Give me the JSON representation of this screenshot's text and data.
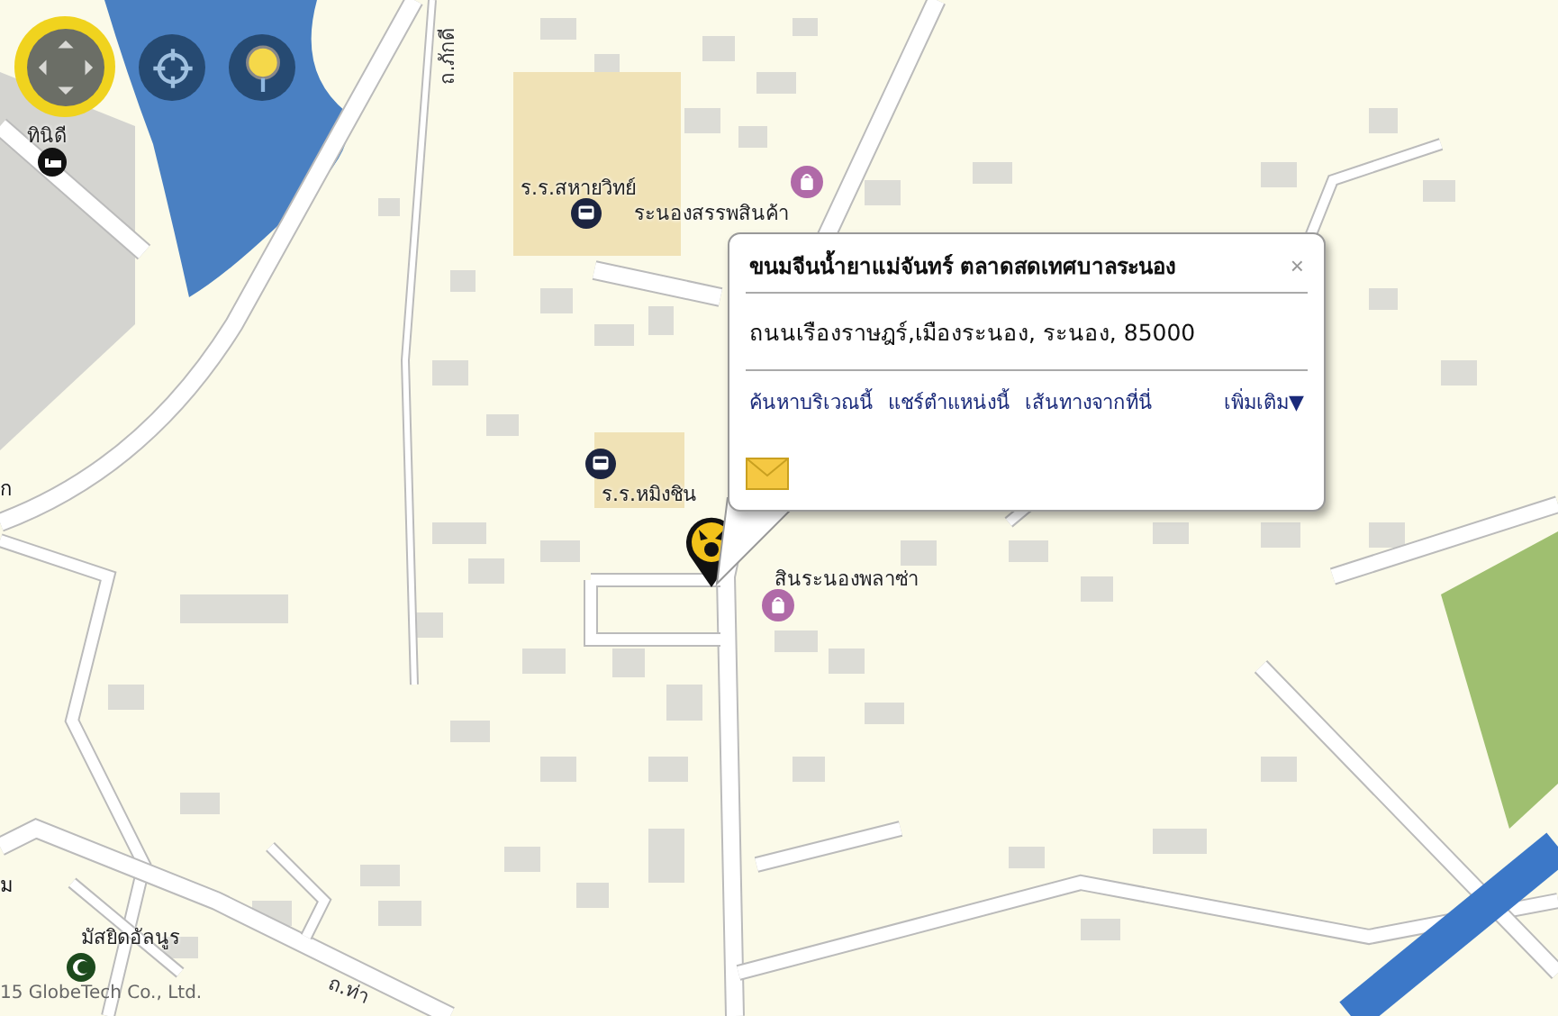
{
  "map_controls": [
    {
      "kind": "pan"
    },
    {
      "kind": "locate"
    },
    {
      "kind": "pin"
    }
  ],
  "map_labels": [
    {
      "text": "ทินิดี",
      "kind": "hotel"
    },
    {
      "text": "ถ.ภักดี",
      "kind": "street"
    },
    {
      "text": "ร.ร.สหายวิทย์",
      "kind": "school"
    },
    {
      "text": "ระนองสรรพสินค้า",
      "kind": "shop"
    },
    {
      "text": "ร.ร.หมิงชิน",
      "kind": "school"
    },
    {
      "text": "สินระนองพลาซ่า",
      "kind": "shop"
    },
    {
      "text": "ก",
      "kind": "area"
    },
    {
      "text": "ม",
      "kind": "area"
    },
    {
      "text": "มัสยิดอัลนูร",
      "kind": "mosque"
    },
    {
      "text": "ถ.ท่า",
      "kind": "street"
    }
  ],
  "popup": {
    "title": "ขนมจีนน้ำยาแม่จันทร์ ตลาดสดเทศบาลระนอง",
    "close": "×",
    "address": "ถนนเรืองราษฎร์,เมืองระนอง, ระนอง, 85000",
    "links": [
      {
        "text": "ค้นหาบริเวณนี้"
      },
      {
        "text": "แชร์ตำแหน่งนี้"
      },
      {
        "text": "เส้นทางจากที่นี่"
      },
      {
        "text": "เพิ่มเติม▼"
      }
    ]
  },
  "copyright": "15 GlobeTech Co., Ltd."
}
